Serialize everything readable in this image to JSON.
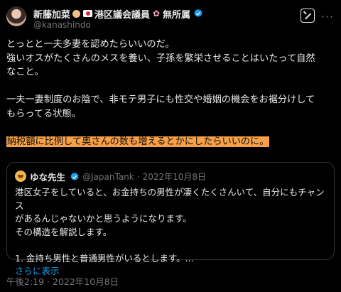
{
  "author": {
    "name": "新藤加菜",
    "name_suffix": "港区議会議員",
    "name_suffix2": "無所属",
    "handle": "@kanashindo"
  },
  "tweet": {
    "line1": "とっとと一夫多妻を認めたらいいのだ。",
    "line2": "強いオスがたくさんのメスを養い、子孫を繁栄させることはいたって自然",
    "line3": "なこと。",
    "line4": "一夫一妻制度のお陰で、非モテ男子にも性交や婚姻の機会をお裾分けして",
    "line5": "もらってる状態。",
    "highlight": "納税額に比例して奥さんの数も増えるとかにしたらいいのに。"
  },
  "quote": {
    "name": "ゆな先生",
    "handle": "@JapanTank",
    "separator": "·",
    "date": "2022年10月8日",
    "line1": "港区女子をしていると、お金持ちの男性が凄くたくさんいて、自分にもチャンス",
    "line2": "があるんじゃないかと思うようになります。",
    "line3": "その構造を解説します。",
    "line4": "1. 金持ち男性と普通男性がいるとします。...",
    "show_more": "さらに表示"
  },
  "timestamp": "午後2:19 · 2022年10月8日",
  "colors": {
    "highlight": "#f7a047",
    "verified": "#1d9bf0",
    "link": "#1d9bf0"
  },
  "icons": {
    "grok": "grok-icon",
    "more": "more-icon",
    "verified": "verified-badge-icon"
  }
}
